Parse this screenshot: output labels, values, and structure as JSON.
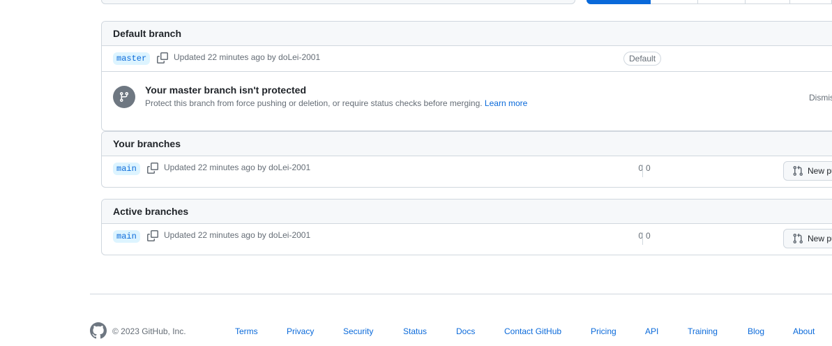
{
  "default_branch": {
    "title": "Default branch",
    "branch": "master",
    "updated": "Updated 22 minutes ago by doLei-2001",
    "badge": "Default",
    "protection": {
      "title": "Your master branch isn't protected",
      "description": "Protect this branch from force pushing or deletion, or require status checks before merging.",
      "learn_more": "Learn more",
      "dismiss": "Dismiss"
    }
  },
  "your_branches": {
    "title": "Your branches",
    "rows": [
      {
        "branch": "main",
        "updated": "Updated 22 minutes ago by doLei-2001",
        "behind": "0",
        "ahead": "0",
        "pr_label": "New pull request"
      }
    ]
  },
  "active_branches": {
    "title": "Active branches",
    "rows": [
      {
        "branch": "main",
        "updated": "Updated 22 minutes ago by doLei-2001",
        "behind": "0",
        "ahead": "0",
        "pr_label": "New pull request"
      }
    ]
  },
  "footer": {
    "copyright": "© 2023 GitHub, Inc.",
    "links": [
      "Terms",
      "Privacy",
      "Security",
      "Status",
      "Docs",
      "Contact GitHub",
      "Pricing",
      "API",
      "Training",
      "Blog",
      "About"
    ]
  },
  "colors": {
    "accent": "#0969da",
    "muted": "#656d76",
    "border": "#d0d7de"
  }
}
